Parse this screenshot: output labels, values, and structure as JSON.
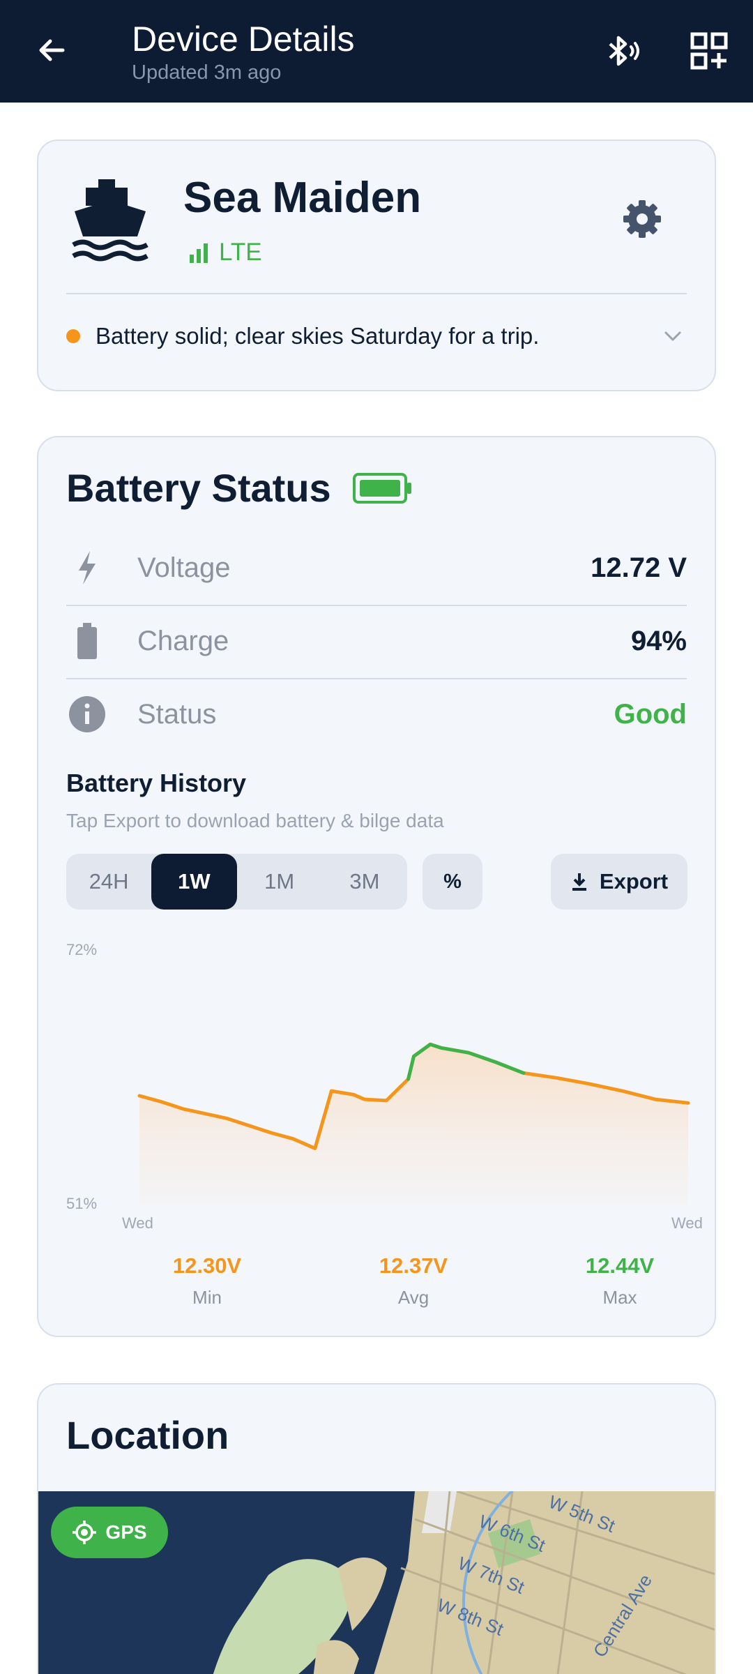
{
  "header": {
    "title": "Device Details",
    "subtitle": "Updated 3m ago",
    "icons": [
      "back-arrow-icon",
      "bluetooth-icon",
      "qr-add-icon"
    ]
  },
  "device": {
    "name": "Sea Maiden",
    "network": "LTE",
    "message": "Battery solid; clear skies Saturday for a trip.",
    "status_dot_color": "#f5951b"
  },
  "battery": {
    "title": "Battery Status",
    "rows": [
      {
        "label": "Voltage",
        "value": "12.72 V",
        "icon": "bolt-icon"
      },
      {
        "label": "Charge",
        "value": "94%",
        "icon": "battery-icon"
      },
      {
        "label": "Status",
        "value": "Good",
        "icon": "info-icon"
      }
    ],
    "history_title": "Battery History",
    "history_subtitle": "Tap Export to download battery & bilge data",
    "ranges": [
      "24H",
      "1W",
      "1M",
      "3M"
    ],
    "selected_range": "1W",
    "unit_toggle": "%",
    "export_label": "Export",
    "stats": [
      {
        "value": "12.30V",
        "label": "Min",
        "color": "#f5951b"
      },
      {
        "value": "12.37V",
        "label": "Avg",
        "color": "#f5951b"
      },
      {
        "value": "12.44V",
        "label": "Max",
        "color": "#3fb24a"
      }
    ]
  },
  "chart_data": {
    "type": "line",
    "ylim": [
      51,
      72
    ],
    "y_tick_labels": [
      "72%",
      "51%"
    ],
    "x_tick_labels": [
      "Wed",
      "Wed"
    ],
    "x": [
      0,
      0.04,
      0.08,
      0.12,
      0.16,
      0.2,
      0.24,
      0.28,
      0.32,
      0.35,
      0.39,
      0.41,
      0.45,
      0.49,
      0.5,
      0.53,
      0.55,
      0.6,
      0.65,
      0.7,
      0.76,
      0.82,
      0.88,
      0.94,
      1.0
    ],
    "y": [
      60.1,
      59.6,
      59.0,
      58.6,
      58.2,
      57.6,
      57.0,
      56.5,
      55.7,
      60.5,
      60.2,
      59.8,
      59.7,
      61.5,
      63.4,
      64.4,
      64.1,
      63.7,
      62.9,
      62.0,
      61.6,
      61.1,
      60.5,
      59.8,
      59.5
    ],
    "series_colors": {
      "normal": "#f5951b",
      "high": "#3fb24a"
    }
  },
  "location": {
    "title": "Location",
    "gps_label": "GPS",
    "streets": [
      "W 5th St",
      "W 6th St",
      "W 7th St",
      "W 8th St",
      "Central Ave"
    ]
  }
}
